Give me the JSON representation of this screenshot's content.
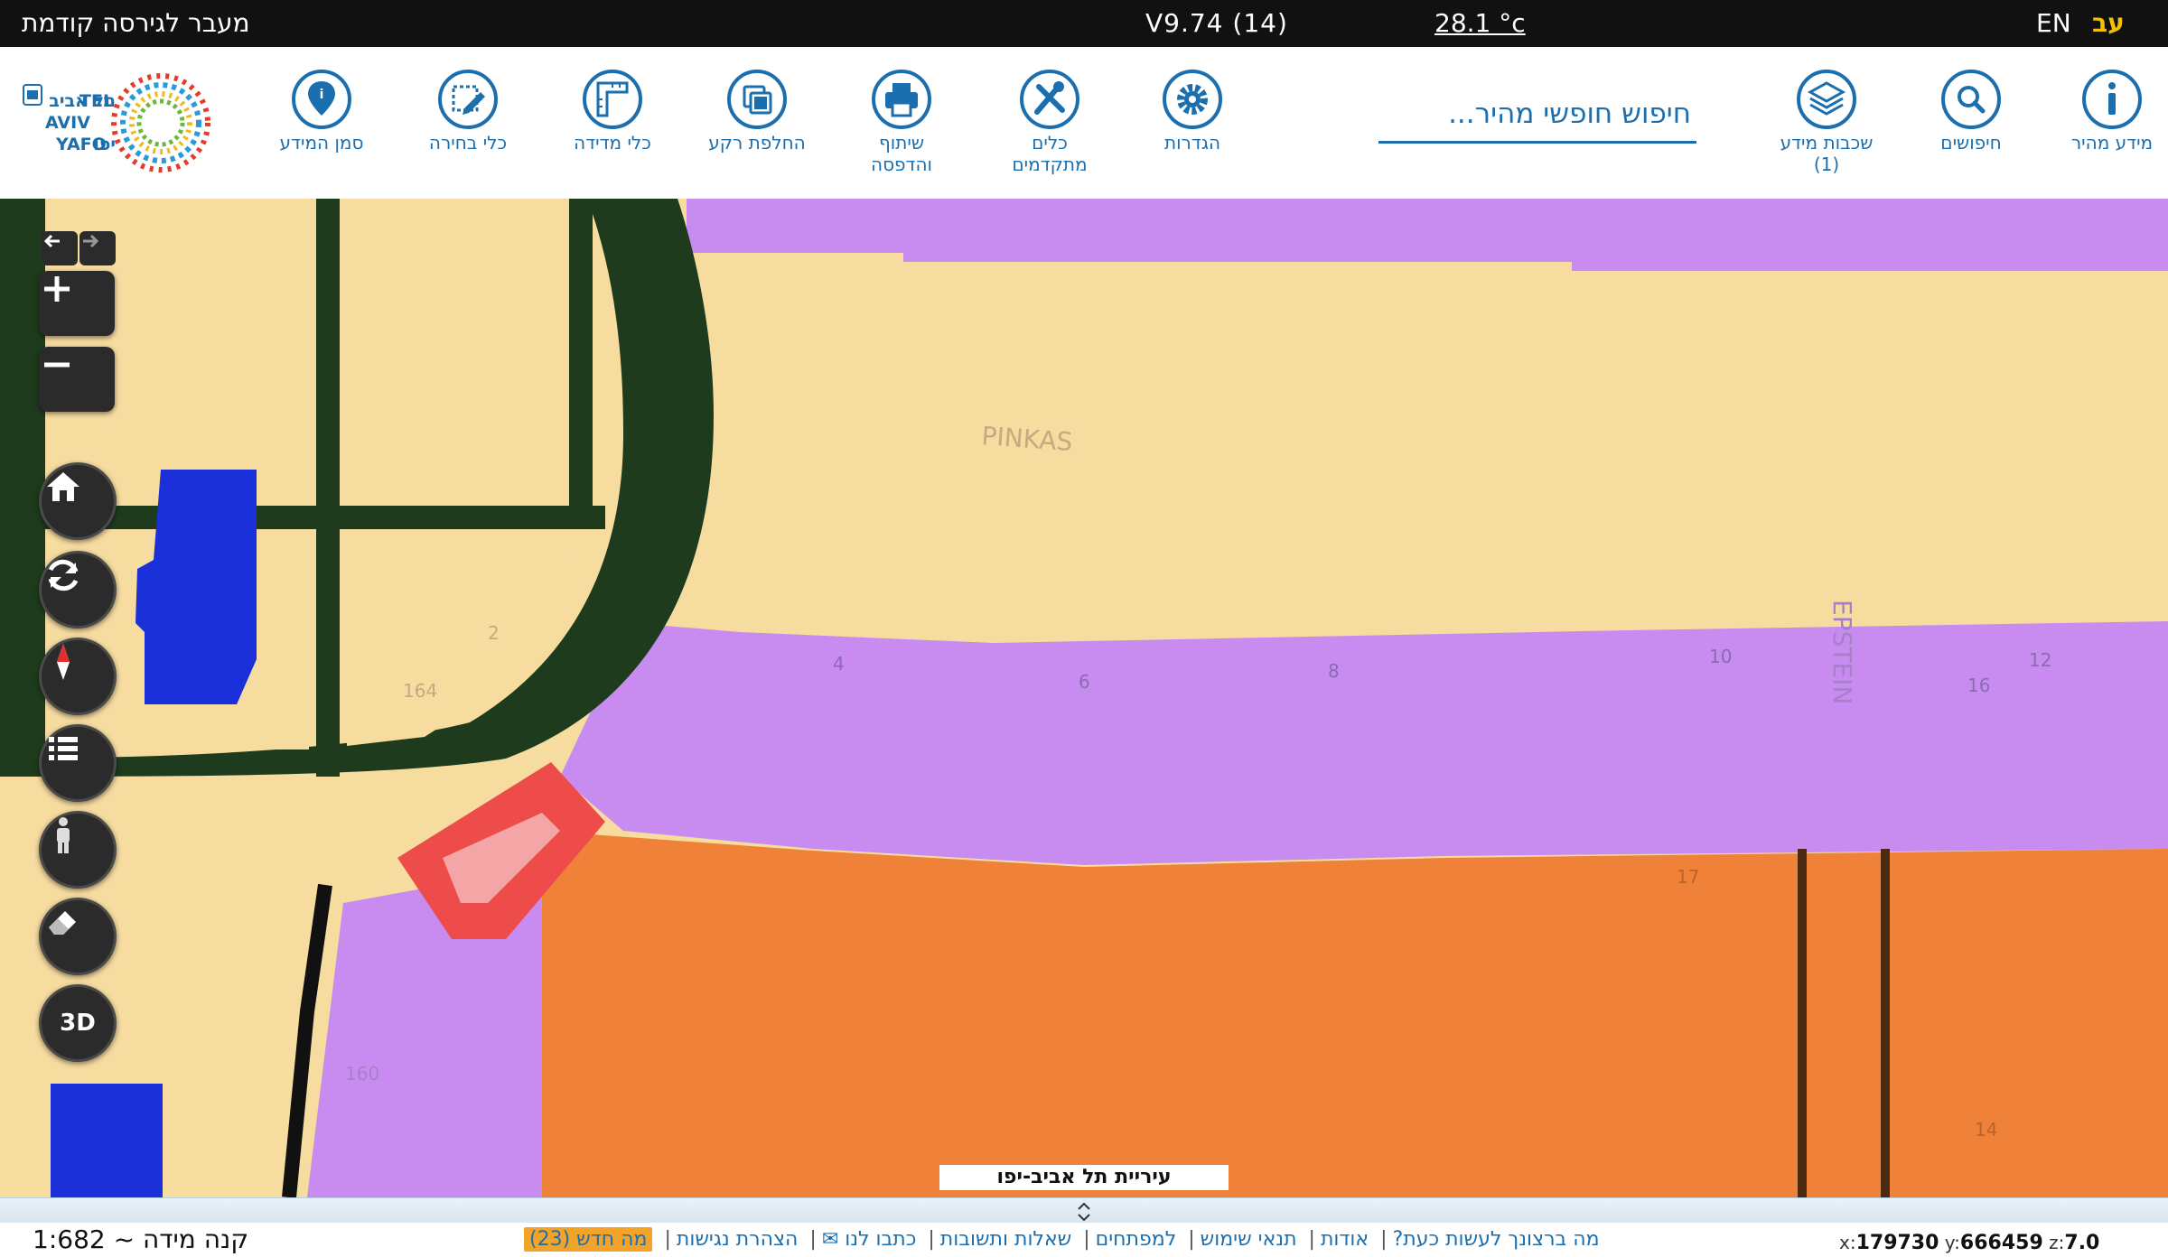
{
  "topbar": {
    "prev_version": "מעבר לגירסה קודמת",
    "version": "V9.74 (14)",
    "temperature": "28.1 °c",
    "lang_en": "EN",
    "lang_he": "עב"
  },
  "toolbar": {
    "marker": "סמן המידע",
    "select": "כלי בחירה",
    "measure": "כלי מדידה",
    "basemap": "החלפת רקע",
    "share": "שיתוף\nוהדפסה",
    "advanced": "כלים\nמתקדמים",
    "settings": "הגדרות",
    "layers": "שכבות מידע\n(1)",
    "searches": "חיפושים",
    "quick_info": "מידע מהיר"
  },
  "search": {
    "placeholder": "חיפוש חופשי מהיר..."
  },
  "map": {
    "city_label": "עיריית תל אביב-יפו",
    "streets": [
      "PINKAS",
      "EPSTEIN"
    ],
    "parcels": [
      "4",
      "6",
      "8",
      "10",
      "12",
      "16",
      "17",
      "14",
      "164",
      "160",
      "2"
    ],
    "btn_3d": "3D"
  },
  "logo": {
    "he": "תל אביב",
    "yafo_he": "יפו",
    "en1": "TEL",
    "en2": "AVIV",
    "en3": "YAFO"
  },
  "statusbar": {
    "scale": "קנה מידה ~ 1:682",
    "links": [
      "מה ברצונך לעשות כעת?",
      "אודות",
      "תנאי שימוש",
      "למפתחים",
      "שאלות ותשובות",
      "כתבו לנו ✉",
      "הצהרת נגישות"
    ],
    "whats_new": "מה חדש (23)",
    "coords": {
      "x_label": "x:",
      "x": "179730",
      "y_label": "y:",
      "y": "666459",
      "z_label": "z:",
      "z": "7.0"
    }
  },
  "colors": {
    "accent": "#1b6fae",
    "residential": "#f7dca0",
    "public": "#c88cf0",
    "commercial": "#ef8238",
    "park": "#1e3b1e",
    "water": "#1b30d8",
    "road": "#f4a6a6"
  }
}
